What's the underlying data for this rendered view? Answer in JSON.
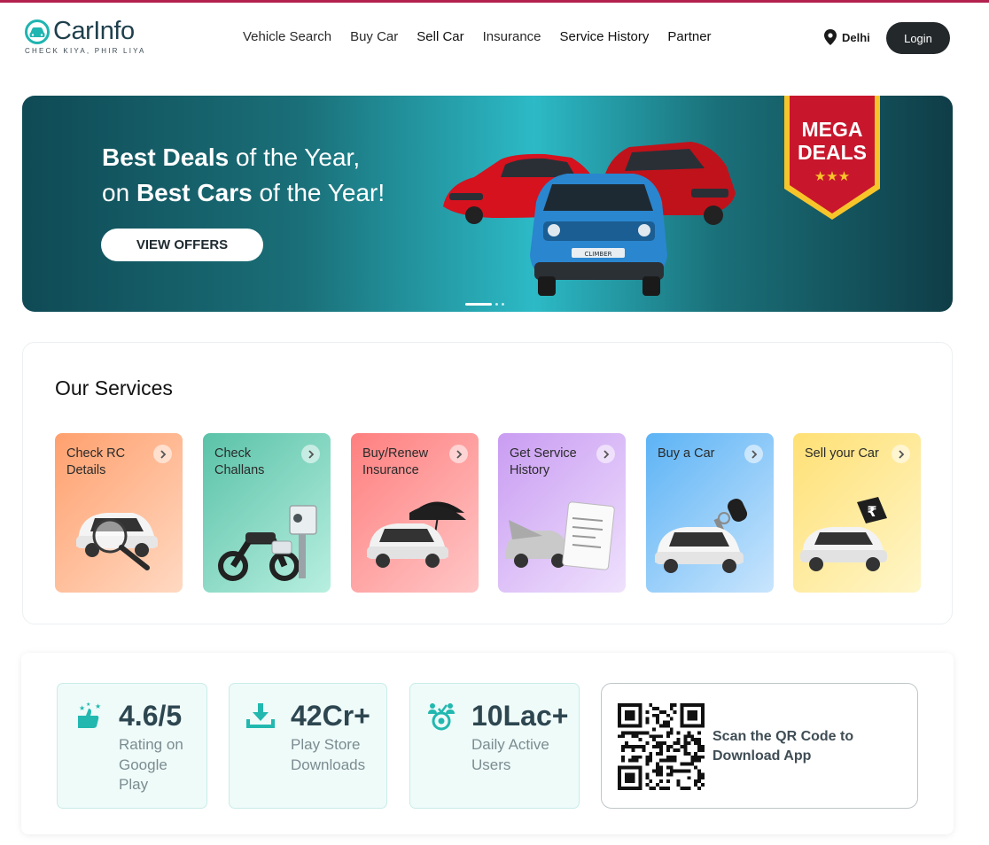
{
  "brand": {
    "name": "CarInfo",
    "tagline": "CHECK KIYA, PHIR LIYA",
    "accent": "#1fb5b1",
    "top_bar_color": "#b3214f"
  },
  "nav": {
    "items": [
      {
        "label": "Vehicle Search"
      },
      {
        "label": "Buy Car"
      },
      {
        "label": "Sell Car"
      },
      {
        "label": "Insurance"
      },
      {
        "label": "Service History"
      },
      {
        "label": "Partner"
      }
    ],
    "location": "Delhi",
    "location_icon": "map-pin-icon",
    "login_label": "Login"
  },
  "banner": {
    "line1_bold": "Best Deals",
    "line1_rest": " of the Year,",
    "line2_pre": "on ",
    "line2_bold": "Best Cars",
    "line2_rest": " of the Year!",
    "cta_label": "VIEW OFFERS",
    "badge_line1": "MEGA",
    "badge_line2": "DEALS",
    "car_plate_text": "CLIMBER",
    "slides_total": 3,
    "slide_active": 1
  },
  "services": {
    "title": "Our Services",
    "cards": [
      {
        "label": "Check RC Details",
        "icon": "magnifier-car-icon",
        "gradient": [
          "#ffa06e",
          "#ffd9c2"
        ]
      },
      {
        "label": "Check Challans",
        "icon": "traffic-camera-icon",
        "gradient": [
          "#5ac2a8",
          "#b8efe0"
        ]
      },
      {
        "label": "Buy/Renew Insurance",
        "icon": "umbrella-car-icon",
        "gradient": [
          "#ff8585",
          "#ffc6c6"
        ]
      },
      {
        "label": "Get Service History",
        "icon": "document-car-icon",
        "gradient": [
          "#c99cf2",
          "#efe1fd"
        ]
      },
      {
        "label": "Buy a Car",
        "icon": "car-key-icon",
        "gradient": [
          "#62b6f6",
          "#c9e5fd"
        ]
      },
      {
        "label": "Sell your Car",
        "icon": "price-tag-car-icon",
        "gradient": [
          "#ffe283",
          "#fff6c8"
        ]
      }
    ]
  },
  "stats": [
    {
      "value": "4.6/5",
      "label": "Rating on Google Play",
      "icon": "thumbs-up-stars-icon"
    },
    {
      "value": "42Cr+",
      "label": "Play Store Downloads",
      "icon": "download-icon"
    },
    {
      "value": "10Lac+",
      "label": "Daily Active Users",
      "icon": "users-target-icon"
    }
  ],
  "qr": {
    "text": "Scan the QR Code to Download App",
    "icon": "qr-code-icon"
  }
}
